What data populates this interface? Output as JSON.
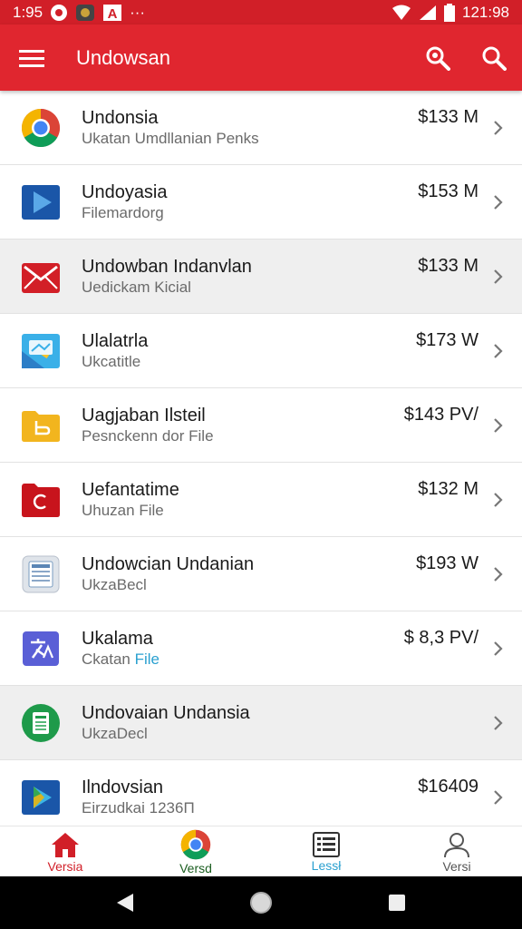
{
  "status_bar": {
    "time": "1:95",
    "right_time": "121:98",
    "app_badge_letter": "A",
    "more": "···"
  },
  "app_bar": {
    "title": "Undowsan",
    "icons": [
      "menu-icon",
      "search-alt-icon",
      "search-icon"
    ]
  },
  "colors": {
    "primary": "#e0262f",
    "status": "#d11f28",
    "accent_blue": "#2aa0d0",
    "nav_active": "#d11f28"
  },
  "list": [
    {
      "icon": "chrome-icon",
      "title": "Undonsia",
      "subtitle": "Ukatan Umdllanian Penks",
      "price": "$133 M",
      "shaded": false
    },
    {
      "icon": "play-icon",
      "title": "Undoyasia",
      "subtitle": "Filemardorg",
      "price": "$153 M",
      "shaded": false
    },
    {
      "icon": "mail-icon",
      "title": "Undowban Indanvlan",
      "subtitle": "Uedickam Kicial",
      "price": "$133 M",
      "shaded": true
    },
    {
      "icon": "map-icon",
      "title": "Ulalatrla",
      "subtitle": "Ukcatitle",
      "price": "$173 W",
      "shaded": false
    },
    {
      "icon": "folder-icon",
      "title": "Uagjaban Ilsteil",
      "subtitle": "Pesnckenn dor File",
      "price": "$143 PV/",
      "shaded": false
    },
    {
      "icon": "red-folder-icon",
      "title": "Uefantatime",
      "subtitle": "Uhuzan File",
      "price": "$132 M",
      "shaded": false
    },
    {
      "icon": "calculator-icon",
      "title": "Undowcian Undanian",
      "subtitle": "UkzaBecl",
      "price": "$193 W",
      "shaded": false
    },
    {
      "icon": "translate-icon",
      "title": "Ukalama",
      "subtitle": "Ckatan",
      "subtitle_accent": "File",
      "price": "$ 8,3 PV/",
      "shaded": false
    },
    {
      "icon": "sheets-icon",
      "title": "Undovaian Undansia",
      "subtitle": "UkzaDecl",
      "price": "",
      "shaded": true
    },
    {
      "icon": "play-store-icon",
      "title": "Ilndovsian",
      "subtitle": "Eirzudkai 1236П",
      "price": "$16409",
      "shaded": false
    }
  ],
  "bottom_nav": [
    {
      "icon": "home-icon",
      "label": "Versia",
      "color": "#d11f28"
    },
    {
      "icon": "chrome-icon",
      "label": "Versd",
      "color": "#1b8a2f"
    },
    {
      "icon": "list-icon",
      "label": "Lessł",
      "color": "#2aa0d0"
    },
    {
      "icon": "person-icon",
      "label": "Versi",
      "color": "#555555"
    }
  ]
}
